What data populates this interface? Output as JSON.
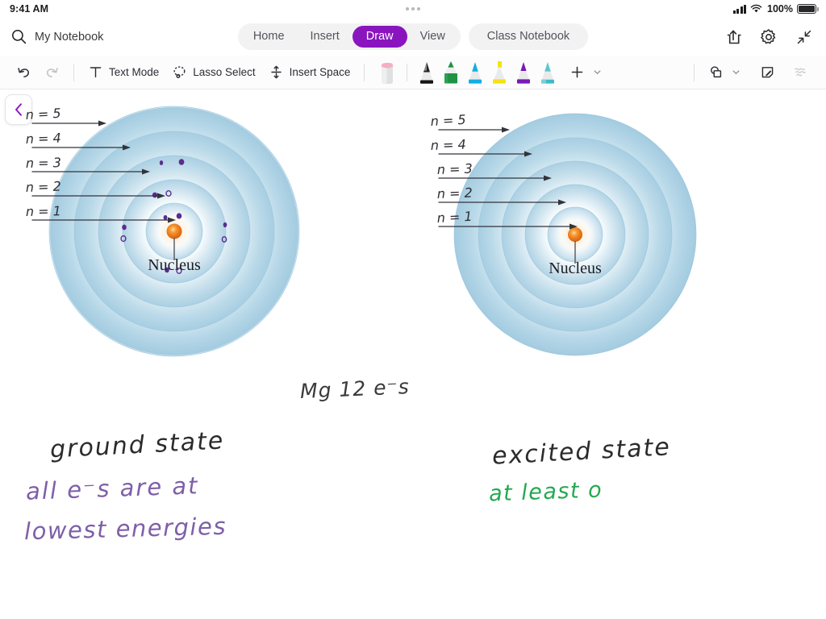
{
  "status_bar": {
    "time": "9:41 AM",
    "battery_percent": "100%",
    "icons": [
      "cellular-signal-icon",
      "wifi-icon",
      "battery-icon"
    ]
  },
  "ribbon": {
    "search_icon": "search-icon",
    "notebook_title": "My Notebook",
    "tabs": [
      {
        "label": "Home",
        "active": false
      },
      {
        "label": "Insert",
        "active": false
      },
      {
        "label": "Draw",
        "active": true
      },
      {
        "label": "View",
        "active": false
      }
    ],
    "class_notebook_tab": "Class Notebook",
    "active_tab_color": "#8A15BE",
    "right_icons": [
      "share-icon",
      "gear-icon",
      "collapse-ribbon-icon"
    ]
  },
  "toolbar": {
    "undo_label": "undo-icon",
    "redo_label": "redo-icon",
    "text_mode": "Text Mode",
    "lasso_select": "Lasso Select",
    "insert_space": "Insert Space",
    "pens": [
      {
        "name": "eraser",
        "color": "#f2a0b8",
        "body": "#dddee0"
      },
      {
        "name": "pen-black",
        "color": "#1b1b1b",
        "body": "#e3e4e6"
      },
      {
        "name": "pen-green",
        "color": "#1e9344",
        "body": "#e3e4e6"
      },
      {
        "name": "pen-cyan",
        "color": "#13aee0",
        "body": "#e3e4e6"
      },
      {
        "name": "highlighter-yellow",
        "color": "#f4e313",
        "body": "#e3e4e6"
      },
      {
        "name": "pen-purple",
        "color": "#7a18b8",
        "body": "#e3e4e6"
      },
      {
        "name": "highlighter-teal",
        "color": "#3fb9c9",
        "body": "#e3e4e6"
      }
    ],
    "add_pen": "add-pen-icon",
    "shapes": "shapes-icon",
    "sticky_note": "sticky-note-icon",
    "ink_to_shape": "ink-squiggle-icon"
  },
  "canvas": {
    "back_button": "back-chevron-icon",
    "back_color": "#8A15BE",
    "diagrams": [
      {
        "id": "ground-state-atom",
        "title_ink": "ground state",
        "title_color": "#2b2b2b",
        "shell_labels": [
          "n=5",
          "n=4",
          "n=3",
          "n=2",
          "n=1"
        ],
        "nucleus_label": "Nucleus",
        "nucleus_color": "#e8731a",
        "shell_color": "#a9d0e2",
        "has_electrons": true,
        "electron_color": "#5b2d8e",
        "electron_counts_by_shell": [
          2,
          8,
          2
        ],
        "notes": [
          {
            "text": "all e⁻s  are  at",
            "color": "#7e5fa8"
          },
          {
            "text": "lowest energies",
            "color": "#7e5fa8"
          }
        ]
      },
      {
        "id": "excited-state-atom",
        "title_ink": "excited state",
        "title_color": "#2b2b2b",
        "shell_labels": [
          "n=5",
          "n=4",
          "n=3",
          "n=2",
          "n=1"
        ],
        "nucleus_label": "Nucleus",
        "nucleus_color": "#e8731a",
        "shell_color": "#a9d0e2",
        "has_electrons": false,
        "notes": [
          {
            "text": "at  least  o",
            "color": "#22a94f"
          }
        ]
      }
    ],
    "middle_note": {
      "text": "Mg  12 e⁻s",
      "color": "#3a3a3a"
    }
  }
}
